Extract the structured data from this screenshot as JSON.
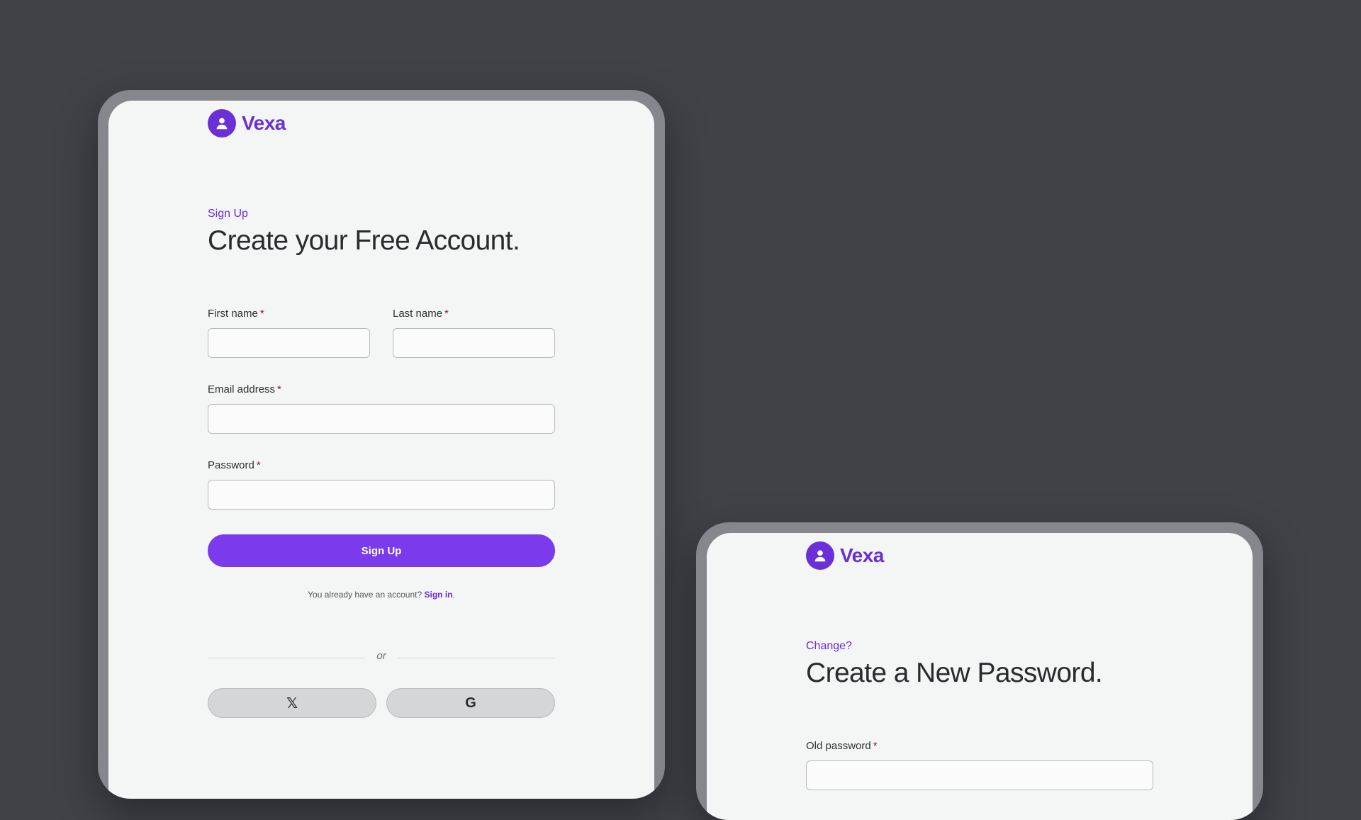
{
  "signup_device": {
    "brand": {
      "name": "Vexa",
      "icon": "user-icon"
    },
    "eyebrow": "Sign Up",
    "title": "Create your Free Account.",
    "fields": {
      "first_name": {
        "label": "First name",
        "required_mark": "*",
        "value": ""
      },
      "last_name": {
        "label": "Last name",
        "required_mark": "*",
        "value": ""
      },
      "email": {
        "label": "Email address",
        "required_mark": "*",
        "value": ""
      },
      "password": {
        "label": "Password",
        "required_mark": "*",
        "value": ""
      }
    },
    "submit_label": "Sign Up",
    "have_account_text": "You already have an account?",
    "signin_link": "Sign in",
    "signin_suffix": ".",
    "divider_text": "or",
    "social": {
      "x_glyph": "𝕏",
      "google_glyph": "G"
    }
  },
  "password_device": {
    "brand": {
      "name": "Vexa",
      "icon": "user-icon"
    },
    "eyebrow": "Change?",
    "title": "Create a New Password.",
    "fields": {
      "old_password": {
        "label": "Old password",
        "required_mark": "*",
        "value": ""
      }
    }
  },
  "colors": {
    "background": "#3f4247",
    "device_frame": "#85878c",
    "screen": "#f4f5f5",
    "brand": "#6a2fd6",
    "primary_button": "#7c3aed",
    "required": "#8a1e2e"
  }
}
